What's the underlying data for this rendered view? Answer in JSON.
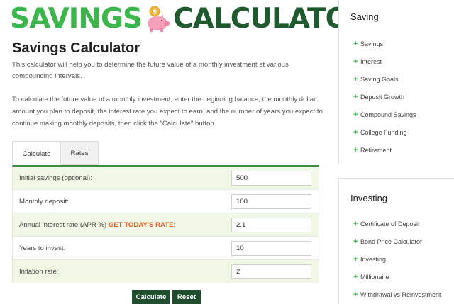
{
  "logo": {
    "word1": "SAVINGS",
    "word2": "CALCULATOR",
    "icon": "piggy-bank-icon",
    "colors": {
      "word1": "#3cb54a",
      "word2": "#1f5a2f",
      "pig": "#f59fb8",
      "coin": "#f2b53a"
    }
  },
  "page_title": "Savings Calculator",
  "intro": "This calculator will help you to determine the future value of a monthly investment at various compounding intervals.",
  "instructions": "To calculate the future value of a monthly investment, enter the beginning balance, the monthly dollar amount you plan to deposit, the interest rate you expect to earn, and the number of years you expect to continue making monthly deposits, then click the \"Calculate\" button.",
  "tabs": [
    {
      "label": "Calculate",
      "active": true
    },
    {
      "label": "Rates",
      "active": false
    }
  ],
  "form": {
    "initial_savings": {
      "label": "Initial savings (optional):",
      "value": "500"
    },
    "monthly_deposit": {
      "label": "Monthly deposit:",
      "value": "100"
    },
    "interest_rate": {
      "label": "Annual interest rate (APR %)",
      "link": "GET TODAY'S RATE",
      "suffix": ":",
      "value": "2.1"
    },
    "years": {
      "label": "Years to invest:",
      "value": "10"
    },
    "inflation": {
      "label": "Inflation rate:",
      "value": "2"
    }
  },
  "buttons": {
    "calculate": "Calculate",
    "reset": "Reset"
  },
  "sidebar": {
    "saving": {
      "title": "Saving",
      "items": [
        "Savings",
        "Interest",
        "Saving Goals",
        "Deposit Growth",
        "Compound Savings",
        "College Funding",
        "Retirement"
      ]
    },
    "investing": {
      "title": "Investing",
      "items": [
        "Certificate of Deposit",
        "Bond Price Calculator",
        "Investing",
        "Millionaire",
        "Withdrawal vs Reinvestment"
      ]
    }
  },
  "colors": {
    "accent_green": "#3cb54a",
    "dark_green": "#1f4d2e",
    "row_alt": "#f0f7e4",
    "rate_link": "#e55a1f"
  }
}
